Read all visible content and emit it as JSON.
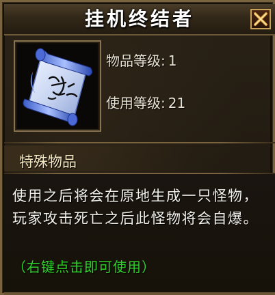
{
  "window": {
    "title": "挂机终结者",
    "close_icon": "close-x-icon",
    "close_symbol": "✕"
  },
  "item": {
    "icon": "scroll-icon",
    "level_label": "物品等级:",
    "level_value": "1",
    "use_level_label": "使用等级:",
    "use_level_value": "21",
    "category": "特殊物品",
    "description": "使用之后将会在原地生成一只怪物，玩家攻击死亡之后此怪物将会自爆。",
    "hint": "（右键点击即可使用）"
  },
  "colors": {
    "border": "#7a6440",
    "title_text": "#ffffff",
    "close_accent": "#e0a040",
    "hint_green": "#2fd12a",
    "body_text": "#f2f0ea"
  }
}
